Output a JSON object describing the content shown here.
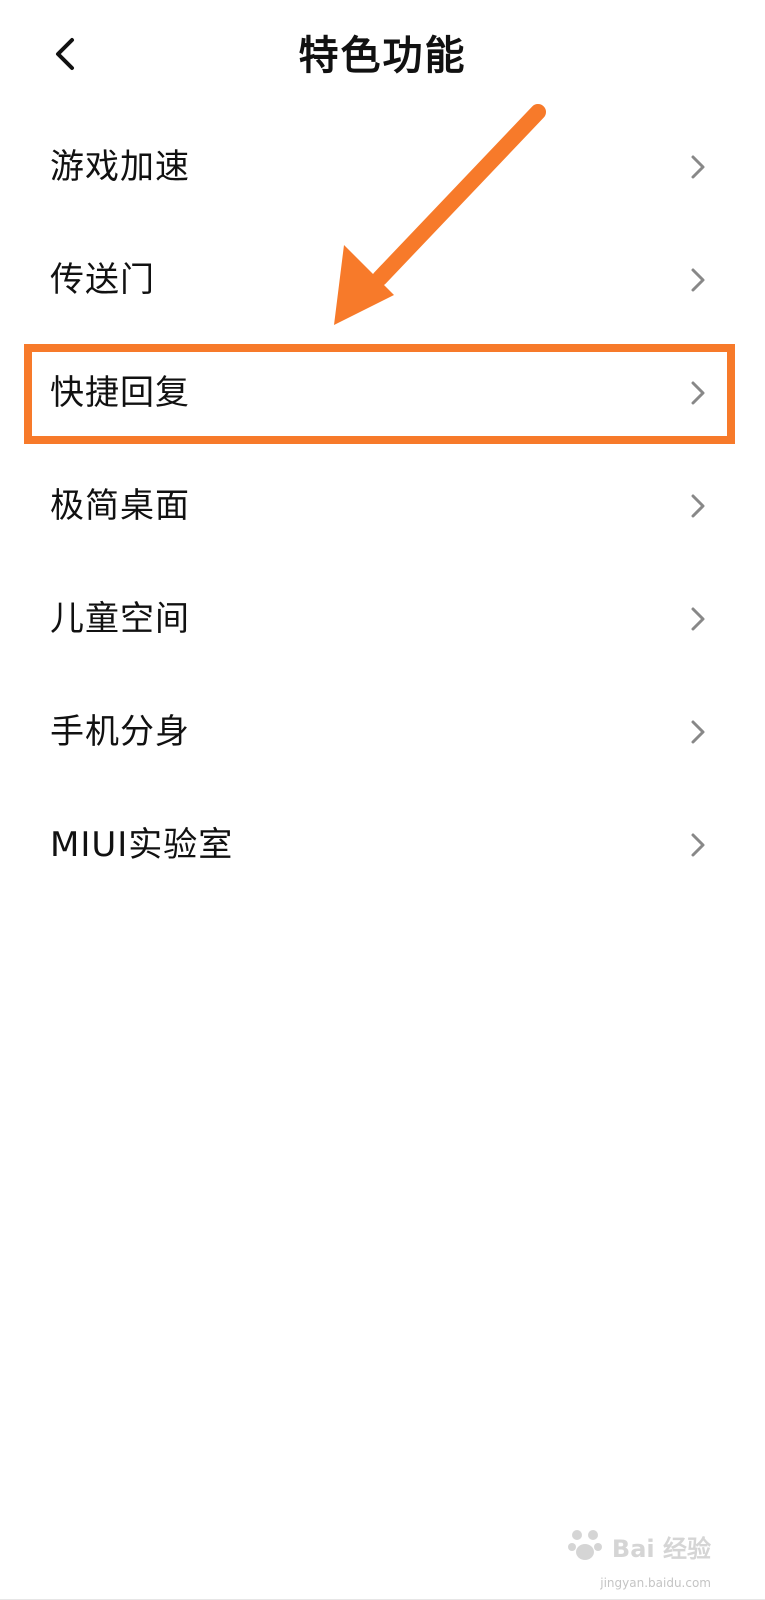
{
  "header": {
    "title": "特色功能",
    "back_icon": "chevron-left-icon"
  },
  "menu": {
    "items": [
      {
        "label": "游戏加速",
        "icon": "chevron-right-icon"
      },
      {
        "label": "传送门",
        "icon": "chevron-right-icon"
      },
      {
        "label": "快捷回复",
        "icon": "chevron-right-icon"
      },
      {
        "label": "极简桌面",
        "icon": "chevron-right-icon"
      },
      {
        "label": "儿童空间",
        "icon": "chevron-right-icon"
      },
      {
        "label": "手机分身",
        "icon": "chevron-right-icon"
      },
      {
        "label": "MIUI实验室",
        "icon": "chevron-right-icon"
      }
    ]
  },
  "annotation": {
    "highlight_color": "#f77a2a",
    "arrow_color": "#f77a2a"
  },
  "watermark": {
    "brand": "Bai 经验",
    "url": "jingyan.baidu.com"
  }
}
